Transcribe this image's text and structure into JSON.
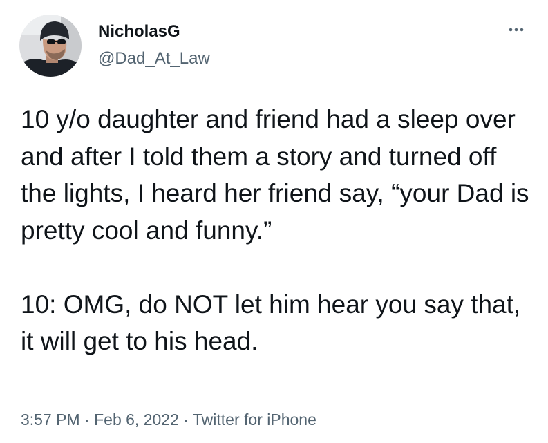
{
  "tweet": {
    "author": {
      "display_name": "NicholasG",
      "handle": "@Dad_At_Law",
      "avatar_icon": "user-avatar-photo"
    },
    "more_icon": "more-options-icon",
    "text": "10 y/o daughter and friend had a sleep over and after I told them a story and turned off the lights, I heard her friend say, “your Dad is pretty cool and funny.”\n\n10: OMG, do NOT let him hear you say that, it will get to his head.",
    "meta": {
      "time": "3:57 PM",
      "separator1": " · ",
      "date": "Feb 6, 2022",
      "separator2": " · ",
      "source": "Twitter for iPhone"
    },
    "colors": {
      "text": "#0f1419",
      "secondary": "#536471",
      "background": "#ffffff"
    }
  }
}
